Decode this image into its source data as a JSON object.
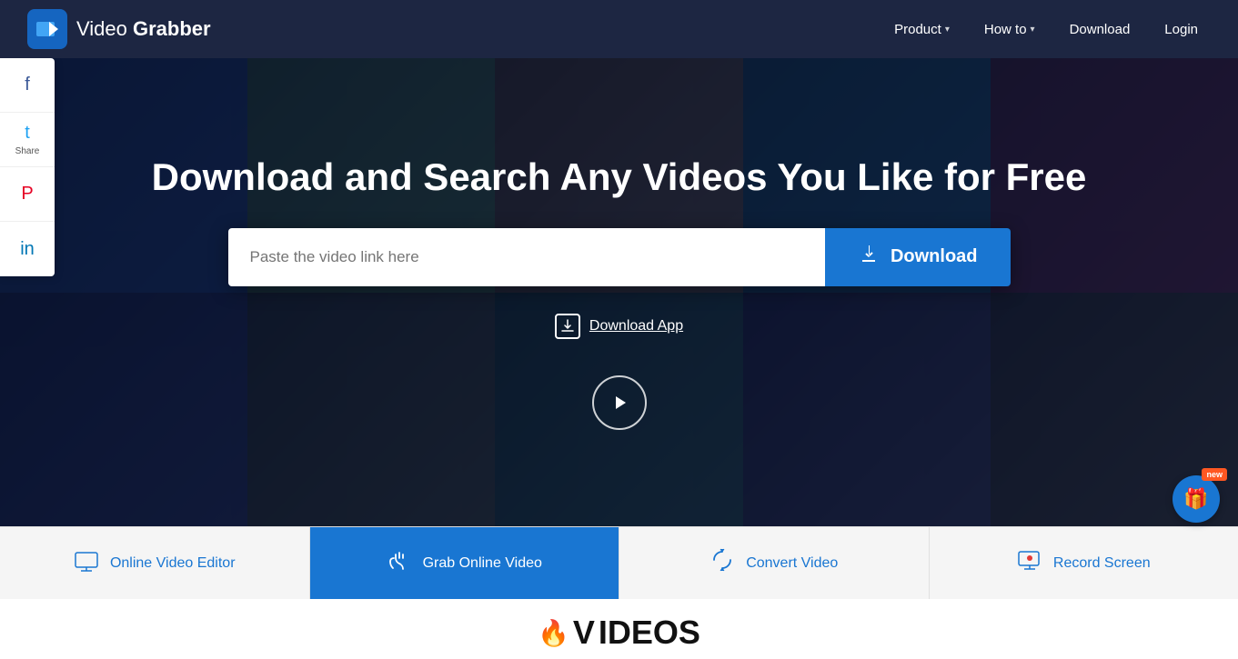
{
  "brand": {
    "name_part1": "Video ",
    "name_part2": "Grabber",
    "logo_emoji": "▶"
  },
  "navbar": {
    "product_label": "Product",
    "howto_label": "How to",
    "download_label": "Download",
    "login_label": "Login"
  },
  "hero": {
    "title": "Download and Search Any Videos You Like for Free",
    "search_placeholder": "Paste the video link here",
    "download_btn_label": "Download",
    "download_app_label": "Download App"
  },
  "social": {
    "share_label": "Share",
    "facebook_icon": "f",
    "twitter_icon": "t",
    "pinterest_icon": "p",
    "linkedin_icon": "in"
  },
  "tabs": [
    {
      "id": "video-editor",
      "label": "Online Video Editor",
      "icon": "🖥"
    },
    {
      "id": "grab-online",
      "label": "Grab Online Video",
      "icon": "✋",
      "active": true
    },
    {
      "id": "convert-video",
      "label": "Convert Video",
      "icon": "🔄"
    },
    {
      "id": "record-screen",
      "label": "Record Screen",
      "icon": "📺"
    }
  ],
  "gift": {
    "icon": "🎁",
    "new_label": "new"
  },
  "videos_section": {
    "label_v": "V",
    "label_rest": "IDEOS"
  }
}
